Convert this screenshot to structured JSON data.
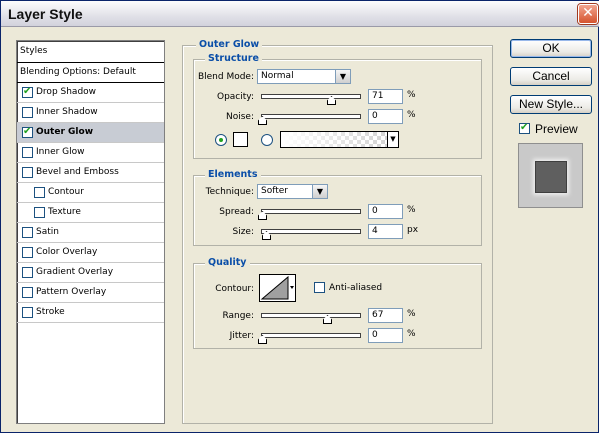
{
  "window": {
    "title": "Layer Style",
    "close_glyph": "✕"
  },
  "styles": {
    "header": "Styles",
    "blending_options": "Blending Options: Default",
    "items": [
      {
        "label": "Drop Shadow",
        "checked": true,
        "active": false,
        "sub": false
      },
      {
        "label": "Inner Shadow",
        "checked": false,
        "active": false,
        "sub": false
      },
      {
        "label": "Outer Glow",
        "checked": true,
        "active": true,
        "sub": false
      },
      {
        "label": "Inner Glow",
        "checked": false,
        "active": false,
        "sub": false
      },
      {
        "label": "Bevel and Emboss",
        "checked": false,
        "active": false,
        "sub": false
      },
      {
        "label": "Contour",
        "checked": false,
        "active": false,
        "sub": true
      },
      {
        "label": "Texture",
        "checked": false,
        "active": false,
        "sub": true
      },
      {
        "label": "Satin",
        "checked": false,
        "active": false,
        "sub": false
      },
      {
        "label": "Color Overlay",
        "checked": false,
        "active": false,
        "sub": false
      },
      {
        "label": "Gradient Overlay",
        "checked": false,
        "active": false,
        "sub": false
      },
      {
        "label": "Pattern Overlay",
        "checked": false,
        "active": false,
        "sub": false
      },
      {
        "label": "Stroke",
        "checked": false,
        "active": false,
        "sub": false
      }
    ]
  },
  "outer_glow": {
    "title": "Outer Glow",
    "structure": {
      "title": "Structure",
      "blend_mode_label": "Blend Mode:",
      "blend_mode_value": "Normal",
      "opacity_label": "Opacity:",
      "opacity_value": "71",
      "opacity_unit": "%",
      "noise_label": "Noise:",
      "noise_value": "0",
      "noise_unit": "%",
      "glow_color": "#ffffff"
    },
    "elements": {
      "title": "Elements",
      "technique_label": "Technique:",
      "technique_value": "Softer",
      "spread_label": "Spread:",
      "spread_value": "0",
      "spread_unit": "%",
      "size_label": "Size:",
      "size_value": "4",
      "size_unit": "px"
    },
    "quality": {
      "title": "Quality",
      "contour_label": "Contour:",
      "anti_aliased_label": "Anti-aliased",
      "anti_aliased_checked": false,
      "range_label": "Range:",
      "range_value": "67",
      "range_unit": "%",
      "jitter_label": "Jitter:",
      "jitter_value": "0",
      "jitter_unit": "%"
    }
  },
  "buttons": {
    "ok": "OK",
    "cancel": "Cancel",
    "new_style": "New Style...",
    "preview_label": "Preview",
    "preview_checked": true
  },
  "icons": {
    "dropdown": "chevron-down-icon",
    "check": "checkmark-icon",
    "close": "close-icon"
  }
}
